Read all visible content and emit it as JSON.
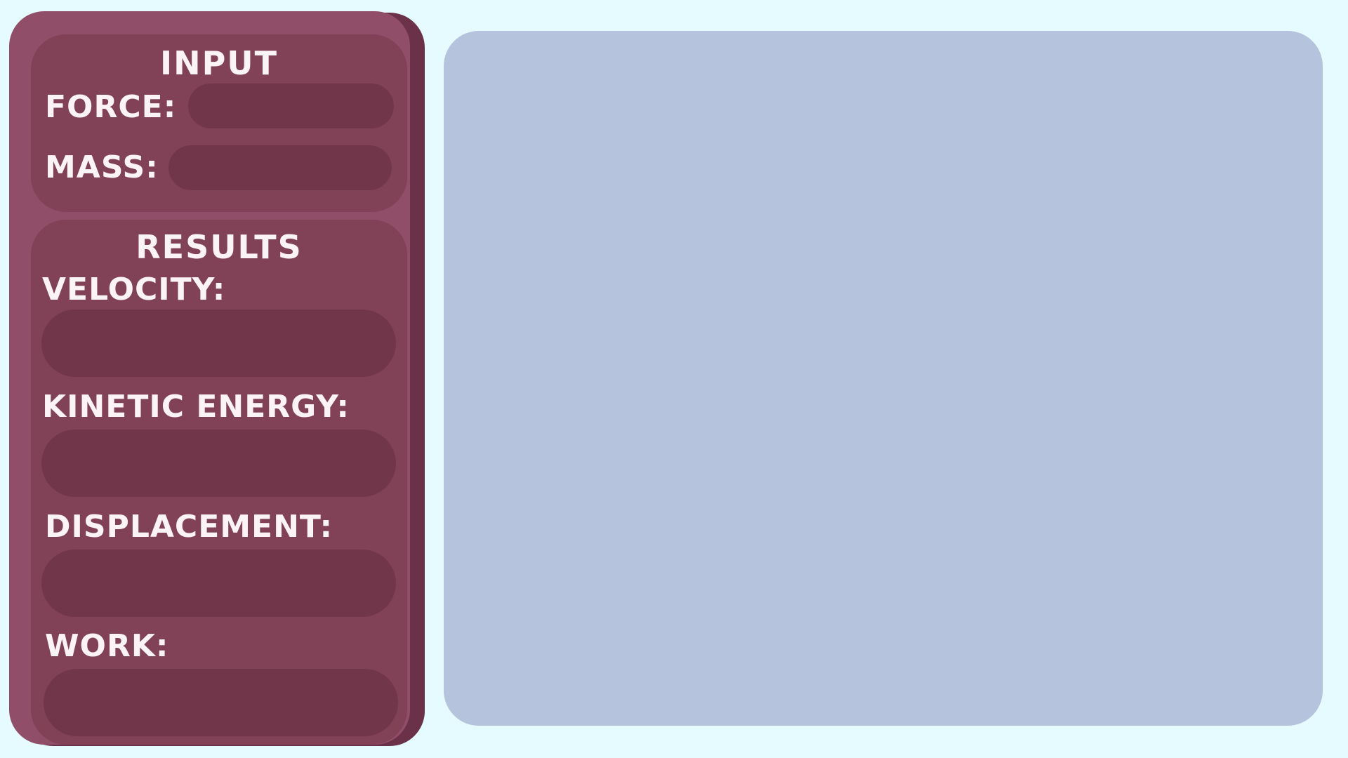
{
  "input": {
    "heading": "INPUT",
    "force_label": "FORCE:",
    "force_value": "",
    "mass_label": "MASS:",
    "mass_value": ""
  },
  "results": {
    "heading": "RESULTS",
    "velocity_label": "VELOCITY:",
    "velocity_value": "",
    "kinetic_energy_label": "KINETIC ENERGY:",
    "kinetic_energy_value": "",
    "displacement_label": "DISPLACEMENT:",
    "displacement_value": "",
    "work_label": "WORK:",
    "work_value": ""
  },
  "colors": {
    "background": "#e6fbff",
    "panel": "#914e68",
    "panel_shadow": "#6a3148",
    "section": "#814258",
    "field": "#72364b",
    "text": "#fbf3f6",
    "canvas": "#b6c3dd"
  }
}
